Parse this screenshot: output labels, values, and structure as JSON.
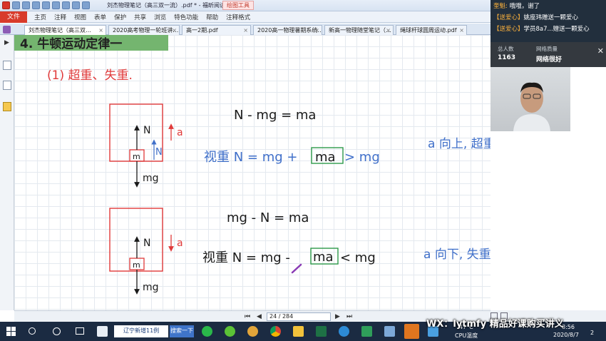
{
  "app": {
    "window_title": "刘杰物理笔记（高三双一流）.pdf * - 福昕阅读器",
    "active_tool_tab": "绘图工具",
    "file_button": "文件",
    "menu": [
      "主页",
      "注释",
      "视图",
      "表单",
      "保护",
      "共享",
      "浏览",
      "特色功能",
      "帮助",
      "注释格式"
    ]
  },
  "doc_tabs": [
    {
      "label": "刘杰物理笔记（高三双…",
      "active": true
    },
    {
      "label": "2020高考物理一轮班讲…",
      "active": false
    },
    {
      "label": "高一2期.pdf",
      "active": false
    },
    {
      "label": "2020高一物理暑期系统…",
      "active": false
    },
    {
      "label": "新高一物理随堂笔记（…",
      "active": false
    },
    {
      "label": "绳球杆球圆周运动.pdf",
      "active": false
    }
  ],
  "note": {
    "heading": "4. 牛顿运动定律一",
    "subheading": "(1) 超重、失重.",
    "case1": {
      "eq1": "N - mg = ma",
      "eq2_prefix": "视重 N = mg +",
      "eq2_box": "ma",
      "eq2_suffix": "> mg",
      "conclusion": "a 向上, 超重.",
      "labels": {
        "normal": "N",
        "weight": "mg",
        "mass": "m",
        "accel": "a",
        "small_normal": "N"
      }
    },
    "case2": {
      "eq1": "mg - N = ma",
      "eq2_prefix": "视重 N = mg -",
      "eq2_box": "ma",
      "eq2_suffix": "< mg",
      "conclusion": "a 向下, 失重",
      "labels": {
        "normal": "N",
        "weight": "mg",
        "mass": "m",
        "accel": "a"
      }
    }
  },
  "statusbar": {
    "page_indicator": "24 / 284",
    "nav": [
      "⏮",
      "◀",
      "▶",
      "⏭"
    ]
  },
  "chat": {
    "line1_user": "奎魁:",
    "line1_text": "哦哦，谢了",
    "line2_tag": "【送爱心】",
    "line2_text": "姚座玮赠送一颗爱心",
    "line3_tag": "【送爱心】",
    "line3_text": "学员8a7...赠送一颗爱心"
  },
  "stats": {
    "viewers_label": "总人数",
    "viewers_value": "1163",
    "network_label": "网络质量",
    "network_value": "网络很好"
  },
  "taskbar": {
    "search_text": "辽宁新增11例",
    "search_button": "搜索一下",
    "cpu_temp": "47°C",
    "cpu_label": "CPU温度",
    "date": "2020/8/7",
    "time": "8:56",
    "notification_count": "2"
  },
  "watermark": "WX：lytmfy 精品好课购买讲义",
  "colors": {
    "heading_bg": "#74b56f",
    "ink_red": "#e03a3a",
    "ink_blue": "#3f6fc9",
    "ink_black": "#1a1a1a",
    "box_green": "#2e9a4a"
  }
}
